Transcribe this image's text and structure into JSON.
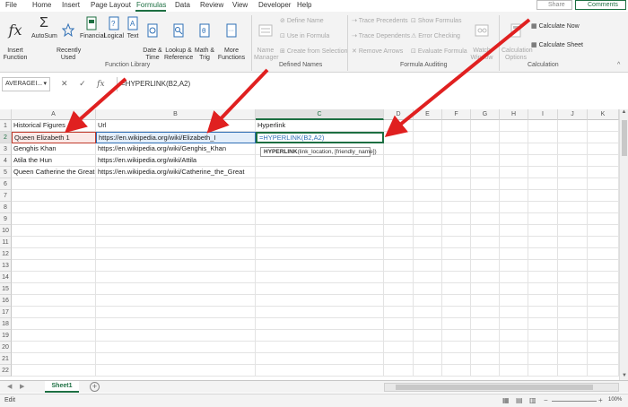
{
  "menu": {
    "tabs": [
      "File",
      "Home",
      "Insert",
      "Page Layout",
      "Formulas",
      "Data",
      "Review",
      "View",
      "Developer",
      "Help"
    ],
    "active_tab": "Formulas",
    "share_label": "Share",
    "comments_label": "Comments"
  },
  "ribbon": {
    "function_library": {
      "insert_function": "Insert\nFunction",
      "autosum": "AutoSum",
      "recently_used": "Recently\nUsed",
      "financial": "Financial",
      "logical": "Logical",
      "text": "Text",
      "date_time": "Date &\nTime",
      "lookup_reference": "Lookup &\nReference",
      "math_trig": "Math &\nTrig",
      "more_functions": "More\nFunctions",
      "group_label": "Function Library"
    },
    "defined_names": {
      "name_manager": "Name\nManager",
      "define_name": "Define Name",
      "use_in_formula": "Use in Formula",
      "create_from_selection": "Create from Selection",
      "group_label": "Defined Names"
    },
    "formula_auditing": {
      "trace_precedents": "Trace Precedents",
      "trace_dependents": "Trace Dependents",
      "remove_arrows": "Remove Arrows",
      "show_formulas": "Show Formulas",
      "error_checking": "Error Checking",
      "evaluate_formula": "Evaluate Formula",
      "watch_window": "Watch\nWindow",
      "group_label": "Formula Auditing"
    },
    "calculation": {
      "calculation_options": "Calculation\nOptions",
      "calculate_now": "Calculate Now",
      "calculate_sheet": "Calculate Sheet",
      "group_label": "Calculation"
    }
  },
  "formula_bar": {
    "name_box": "AVERAGEI...",
    "formula": "=HYPERLINK(B2,A2)"
  },
  "grid": {
    "columns": [
      "A",
      "B",
      "C",
      "D",
      "E",
      "F",
      "G",
      "H",
      "I",
      "J",
      "K"
    ],
    "rows": [
      "1",
      "2",
      "3",
      "4",
      "5",
      "6",
      "7",
      "8",
      "9",
      "10",
      "11",
      "12",
      "13",
      "14",
      "15",
      "16",
      "17",
      "18",
      "19",
      "20",
      "21",
      "22"
    ],
    "cells": [
      [
        "Historical Figures",
        "Url",
        "Hyperlink"
      ],
      [
        "Queen Elizabeth 1",
        "https://en.wikipedia.org/wiki/Elizabeth_I",
        "=HYPERLINK(B2,A2)"
      ],
      [
        "Genghis Khan",
        "https://en.wikipedia.org/wiki/Genghis_Khan",
        ""
      ],
      [
        "Atila the Hun",
        "https://en.wikipedia.org/wiki/Attila",
        ""
      ],
      [
        "Queen Catherine the Great",
        "https://en.wikipedia.org/wiki/Catherine_the_Great",
        ""
      ]
    ],
    "active_cell": "C2"
  },
  "tooltip": {
    "func_name": "HYPERLINK",
    "args": "(link_location, [friendly_name])"
  },
  "sheets": {
    "tabs": [
      "Sheet1"
    ]
  },
  "status": {
    "mode": "Edit",
    "zoom": "100%"
  },
  "colors": {
    "accent": "#1d6f42",
    "arrow": "#e02020",
    "ref_a": "#c0392b",
    "ref_b": "#2e6fb5"
  }
}
